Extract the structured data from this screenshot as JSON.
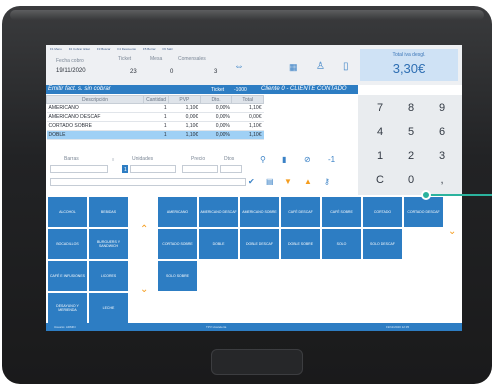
{
  "menu": [
    "F1 Menu",
    "F2 Cobrar ticket",
    "F3 Buscar",
    "F4 Descuento",
    "F5 Borrar",
    "F6 Salir"
  ],
  "header": {
    "fecha_label": "Fecha cobro",
    "fecha_value": "19/11/2020",
    "ticket_label": "Ticket",
    "ticket_value": "23",
    "mesa_label": "Mesa",
    "mesa_value": "0",
    "comensales_label": "Comensales",
    "comensales_value": "3"
  },
  "total": {
    "label": "Total iva desgl.",
    "value": "3,30€"
  },
  "title_bar": {
    "left": "Emitir fact. s. sin cobrar",
    "mid1": "Ticket",
    "mid2": "-1000",
    "right": "Cliente 0 - CLIENTE CONTADO"
  },
  "table": {
    "headers": [
      "Descripción",
      "Cantidad",
      "PVP",
      "Dto.",
      "Total"
    ],
    "rows": [
      {
        "desc": "AMERICANO",
        "cant": "1",
        "pvp": "1,10€",
        "dto": "0,00%",
        "total": "1,10€",
        "selected": false
      },
      {
        "desc": "AMERICANO DESCAF",
        "cant": "1",
        "pvp": "0,00€",
        "dto": "0,00%",
        "total": "0,00€",
        "selected": false
      },
      {
        "desc": "CORTADO SOBRE",
        "cant": "1",
        "pvp": "1,10€",
        "dto": "0,00%",
        "total": "1,10€",
        "selected": false
      },
      {
        "desc": "DOBLE",
        "cant": "1",
        "pvp": "1,10€",
        "dto": "0,00%",
        "total": "1,10€",
        "selected": true
      }
    ]
  },
  "keypad": [
    "7",
    "8",
    "9",
    "4",
    "5",
    "6",
    "1",
    "2",
    "3",
    "C",
    "0",
    ","
  ],
  "fields": {
    "barras_label": "Barras",
    "unidades_label": "Unidades",
    "precio_label": "Precio",
    "dtos_label": "Dtos",
    "unidades_value": "1",
    "minus_one": "-1"
  },
  "tiles": {
    "families": [
      "ALCOHOL",
      "BEBIDAS",
      "BOCADILLOS",
      "BURGUERS Y SANDWICH",
      "CAFÉ E INFUSIONES",
      "LICORES",
      "DESAYUNO Y MERIENDA",
      "LECHE"
    ],
    "products": [
      "AMERICANO",
      "AMERICANO DESCAF",
      "AMERICANO SOBRE",
      "CAFÉ DESCAF",
      "CAFÉ SOBRE",
      "CORTADO",
      "CORTADO DESCAF",
      "CORTADO SOBRE",
      "DOBLE",
      "DOBLE DESCAF",
      "DOBLE SOBRE",
      "SOLO",
      "SOLO DESCAF",
      "SOLO SOBRE"
    ]
  },
  "status": [
    "Usuario: ADMIN",
    "TPV Hostelería",
    "19/11/2020 12:35"
  ],
  "colors": {
    "accent": "#2d7dc3",
    "arrow": "#f59d1e",
    "callout": "#2bb39e",
    "selected_row": "#9fd0f5"
  },
  "icons": [
    "expand-icon",
    "calculator-icon",
    "user-icon",
    "document-icon",
    "search-icon",
    "delete-icon",
    "percent-icon",
    "check-icon",
    "print-icon",
    "arrow-down-icon",
    "arrow-up-icon",
    "key-icon"
  ]
}
